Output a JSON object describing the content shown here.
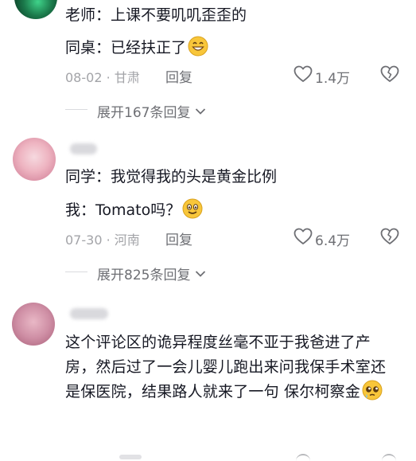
{
  "comments": [
    {
      "lines": [
        "老师：上课不要叽叽歪歪的",
        "同桌：已经扶正了"
      ],
      "date": "08-02",
      "location": "甘肃",
      "reply_label": "回复",
      "likes": "1.4万",
      "expand_label": "展开167条回复"
    },
    {
      "lines": [
        "同学：我觉得我的头是黄金比例",
        "我：Tomato吗？"
      ],
      "date": "07-30",
      "location": "河南",
      "reply_label": "回复",
      "likes": "6.4万",
      "expand_label": "展开825条回复"
    },
    {
      "text": "这个评论区的诡异程度丝毫不亚于我爸进了产房，然后过了一会儿婴儿跑出来问我保手术室还是保医院，结果路人就来了一句  保尔柯察金"
    }
  ],
  "colors": {
    "text": "#161823",
    "meta": "#a3a4a8",
    "secondary": "#6e6f74"
  }
}
